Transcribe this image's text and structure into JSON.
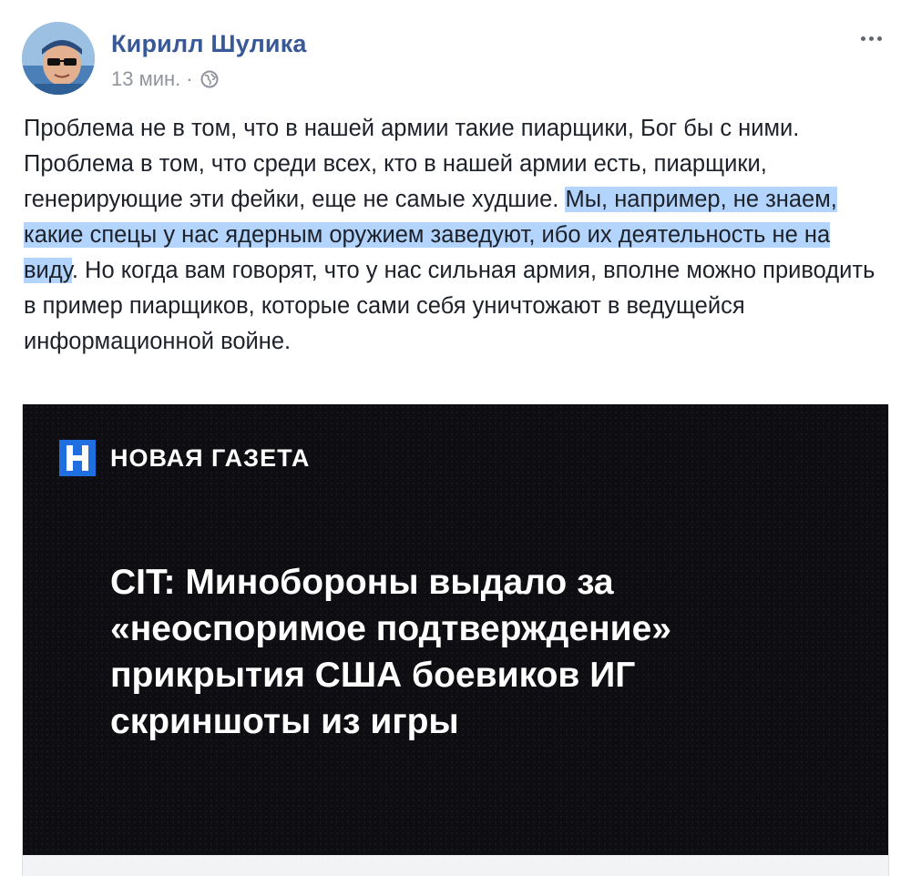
{
  "post": {
    "author": "Кирилл Шулика",
    "time": "13 мин.",
    "separator": "·",
    "text_before": "Проблема не в том, что в нашей армии такие пиарщики, Бог бы с ними. Проблема в том, что среди всех, кто в нашей армии есть, пиарщики, генерирующие эти фейки, еще не самые худшие. ",
    "text_highlighted": "Мы, например, не знаем, какие спецы у нас ядерным оружием заведуют, ибо их деятельность не на виду",
    "text_after": ". Но когда вам говорят, что у нас сильная армия, вполне можно приводить в пример пиарщиков, которые сами себя уничтожают в ведущейся информационной войне."
  },
  "card": {
    "brand": "НОВАЯ ГАЗЕТА",
    "headline": "CIT: Минобороны выдало за «неоспоримое подтверждение» прикрытия США боевиков ИГ скриншоты из игры"
  },
  "icons": {
    "privacy": "globe-icon",
    "menu": "more-options-icon",
    "logo": "novaya-gazeta-logo"
  },
  "colors": {
    "author": "#385898",
    "meta": "#90949c",
    "text": "#1d2129",
    "highlight": "#b3d4fc",
    "card_bg": "#0d0d12",
    "logo_blue": "#1f6fe0"
  }
}
